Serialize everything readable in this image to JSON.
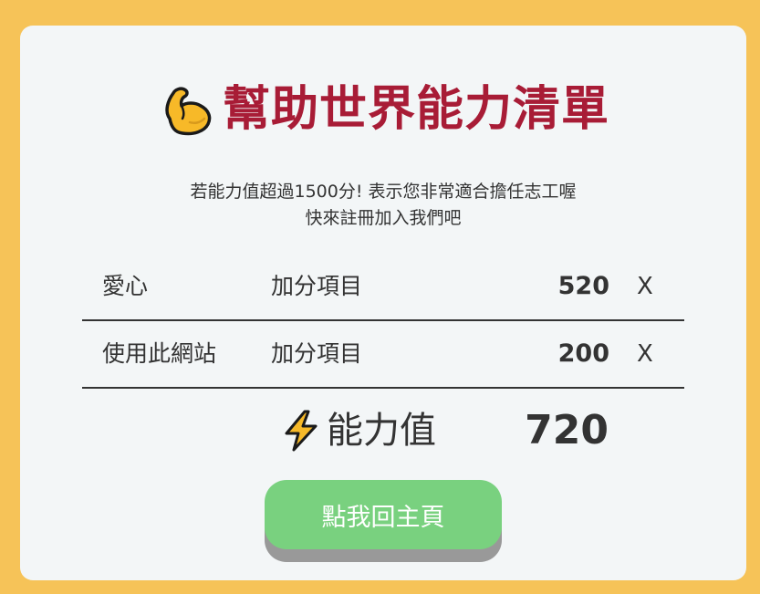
{
  "header": {
    "icon": "flexed-biceps-icon",
    "title": "幫助世界能力清單",
    "subtitle_line1": "若能力值超過1500分! 表示您非常適合擔任志工喔",
    "subtitle_line2": "快來註冊加入我們吧"
  },
  "items": [
    {
      "name": "愛心",
      "type": "加分項目",
      "points": "520",
      "remove_label": "X"
    },
    {
      "name": "使用此網站",
      "type": "加分項目",
      "points": "200",
      "remove_label": "X"
    }
  ],
  "total": {
    "icon": "lightning-bolt-icon",
    "label": "能力值",
    "value": "720"
  },
  "home_button": {
    "label": "點我回主頁"
  },
  "colors": {
    "background": "#f6c358",
    "card": "#f3f6f7",
    "title": "#a81c36",
    "button": "#79d17f",
    "button_shadow": "#999999"
  }
}
